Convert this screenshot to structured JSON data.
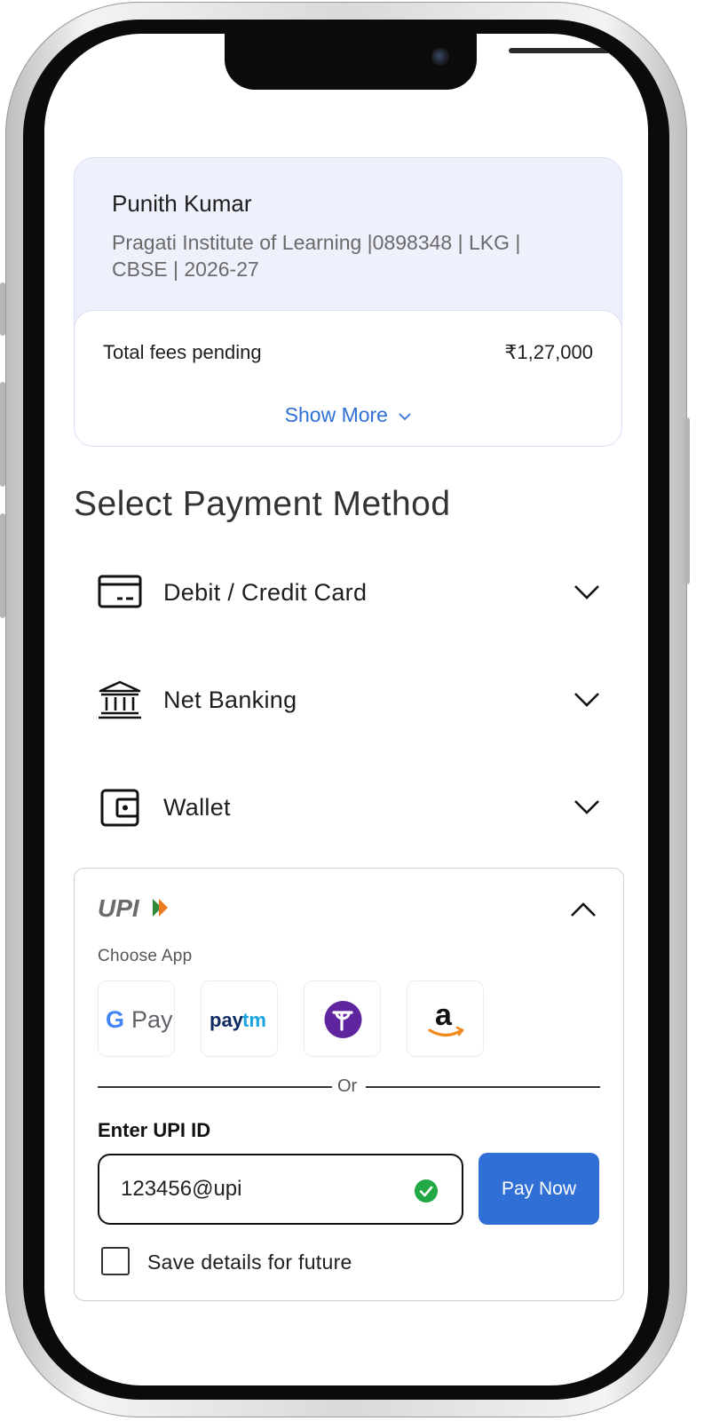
{
  "student": {
    "name": "Punith Kumar",
    "info": "Pragati Institute of Learning |0898348 | LKG | CBSE | 2026-27"
  },
  "fees": {
    "pending_label": "Total fees pending",
    "pending_amount": "₹1,27,000",
    "show_more": "Show More"
  },
  "payment": {
    "title": "Select Payment Method",
    "methods": [
      {
        "label": "Debit / Credit Card",
        "icon": "credit-card-icon"
      },
      {
        "label": "Net Banking",
        "icon": "bank-icon"
      },
      {
        "label": "Wallet",
        "icon": "wallet-icon"
      }
    ]
  },
  "upi": {
    "logo_text": "UPI",
    "choose_app": "Choose App",
    "apps": [
      "G Pay",
      "paytm",
      "PhonePe",
      "Amazon Pay"
    ],
    "or": "Or",
    "enter_label": "Enter UPI ID",
    "id_value": "123456@upi",
    "pay_button": "Pay Now",
    "save_label": "Save details for future",
    "save_checked": false
  },
  "colors": {
    "accent": "#2f6fd6",
    "card_bg": "#eef0fb",
    "success": "#22a845",
    "phonepe": "#5f259f"
  }
}
